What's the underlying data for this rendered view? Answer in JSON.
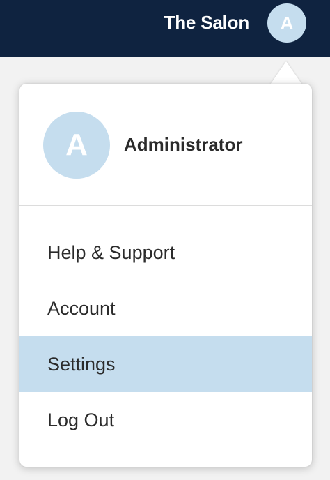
{
  "header": {
    "title": "The Salon",
    "avatar_initial": "A"
  },
  "profile": {
    "avatar_initial": "A",
    "name": "Administrator"
  },
  "menu": {
    "items": [
      {
        "label": "Help & Support",
        "active": false
      },
      {
        "label": "Account",
        "active": false
      },
      {
        "label": "Settings",
        "active": true
      },
      {
        "label": "Log Out",
        "active": false
      }
    ]
  },
  "colors": {
    "header_bg": "#0f2340",
    "avatar_bg": "#c5ddee",
    "highlight_bg": "#c5ddee",
    "text": "#2b2b2b"
  }
}
